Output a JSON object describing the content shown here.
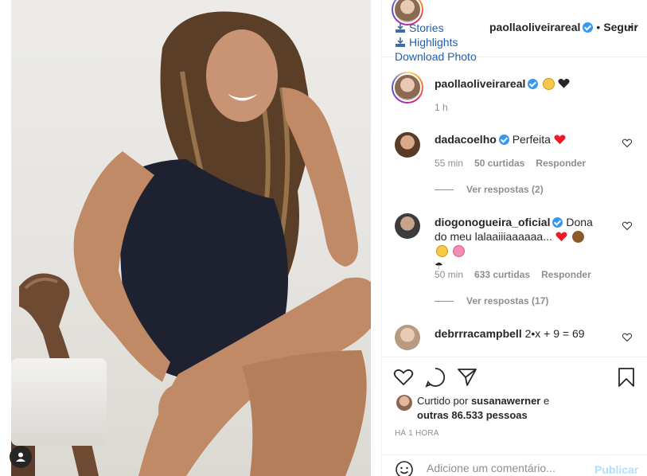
{
  "header": {
    "ext_links": [
      "Stories",
      "Highlights",
      "Download Photo"
    ],
    "username": "paollaoliveirareal",
    "separator": "•",
    "follow_label": "Seguir",
    "more_icon": "more-options-icon"
  },
  "caption": {
    "username": "paollaoliveirareal",
    "emojis": [
      "grinning-face",
      "black-heart"
    ],
    "time": "1 h"
  },
  "comments": [
    {
      "username": "dadacoelho",
      "text": "Perfeita",
      "emoji": "red-heart",
      "time": "55 min",
      "likes": "50 curtidas",
      "reply_label": "Responder",
      "view_replies": "Ver respostas (2)"
    },
    {
      "username": "diogonogueira_oficial",
      "text": "Dona do meu lalaaiiiaaaaaa...",
      "emojis": [
        "red-heart",
        "monkey",
        "winking-face",
        "flower",
        "umbrella"
      ],
      "time": "50 min",
      "likes": "633 curtidas",
      "reply_label": "Responder",
      "view_replies": "Ver respostas (17)"
    },
    {
      "username": "debrrracampbell",
      "text": "2•x + 9 = 69"
    }
  ],
  "actions": {
    "liked_by_prefix": "Curtido por",
    "liked_by_user": "susanawerner",
    "liked_by_and": "e",
    "liked_by_others": "outras 86.533 pessoas",
    "time_ago": "HÁ 1 HORA"
  },
  "comment_box": {
    "placeholder": "Adicione um comentário...",
    "publish_label": "Publicar"
  },
  "colors": {
    "link_blue": "#1f5fb5",
    "verified_blue": "#3897f0",
    "muted": "#8e8e8e",
    "heart_red": "#ed4956",
    "publish_disabled": "#b2dffc"
  }
}
